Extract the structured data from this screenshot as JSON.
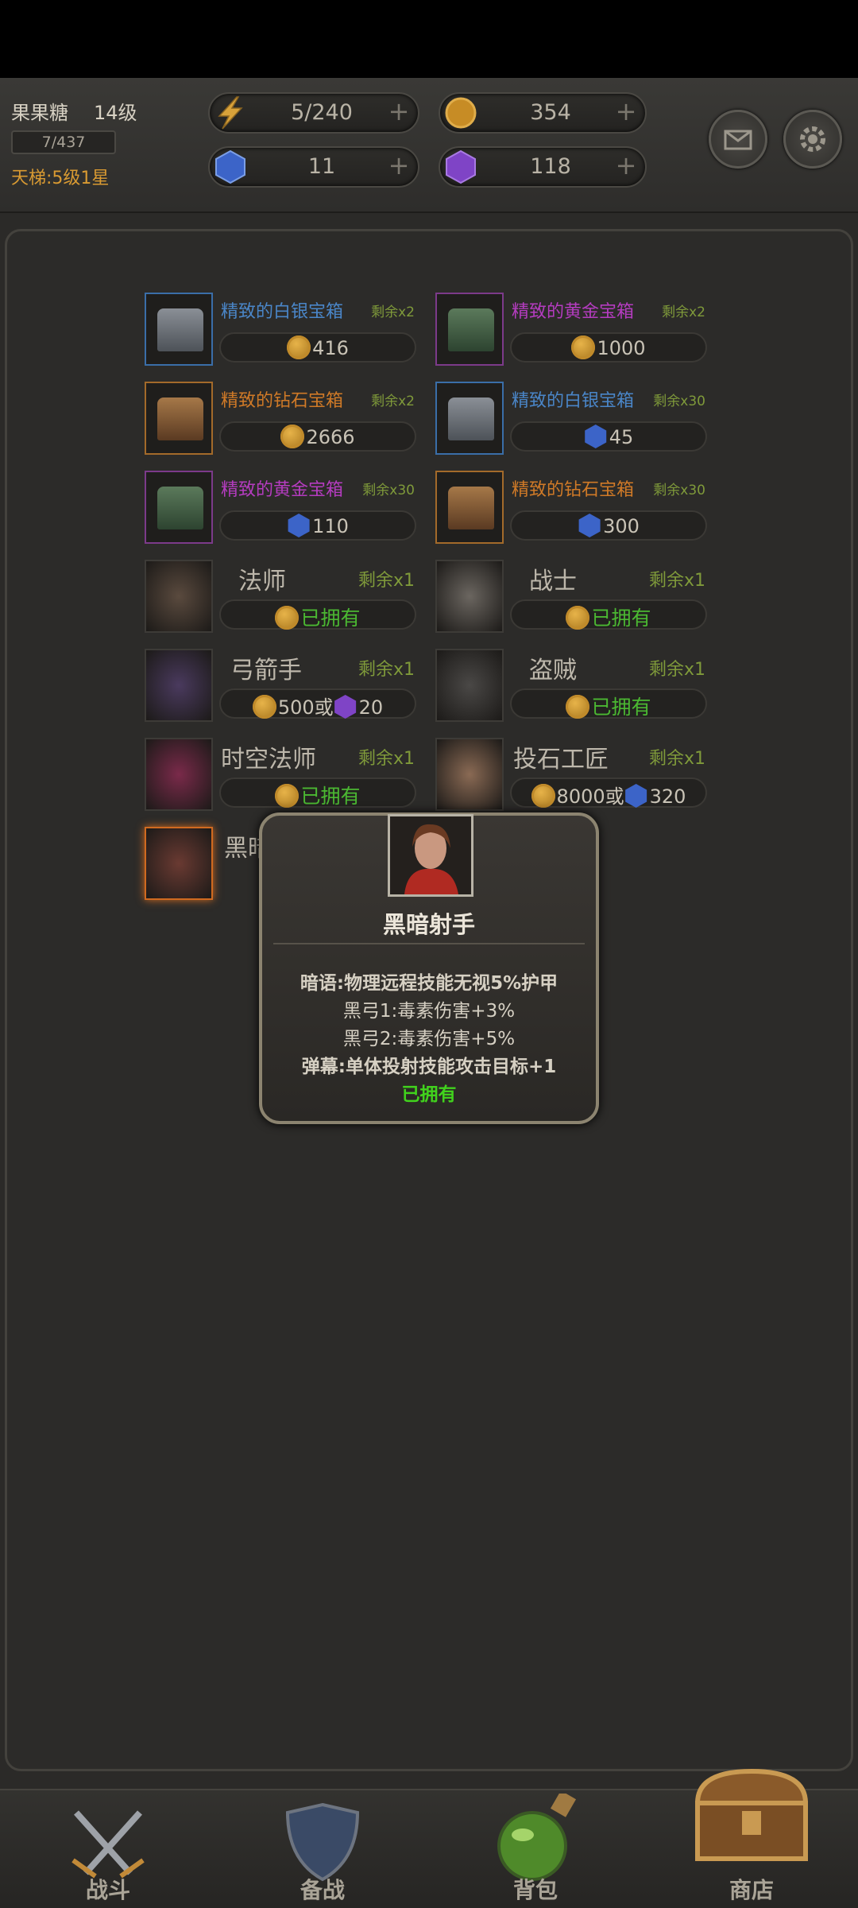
{
  "player": {
    "name": "果果糖",
    "level": "14级",
    "exp": "7/437",
    "ladder": "天梯:5级1星"
  },
  "resources": {
    "energy": "5/240",
    "gold": "354",
    "blue_gem": "11",
    "purple_gem": "118",
    "plus": "+"
  },
  "shop_items": [
    {
      "title": "精致的白银宝箱",
      "remain": "剩余x2",
      "price": "416",
      "currency": "coin",
      "title_color": "#4a86c8"
    },
    {
      "title": "精致的黄金宝箱",
      "remain": "剩余x2",
      "price": "1000",
      "currency": "coin",
      "title_color": "#b53cc0"
    },
    {
      "title": "精致的钻石宝箱",
      "remain": "剩余x2",
      "price": "2666",
      "currency": "coin",
      "title_color": "#d07a27"
    },
    {
      "title": "精致的白银宝箱",
      "remain": "剩余x30",
      "price": "45",
      "currency": "blue_gem",
      "title_color": "#4a86c8"
    },
    {
      "title": "精致的黄金宝箱",
      "remain": "剩余x30",
      "price": "110",
      "currency": "blue_gem",
      "title_color": "#b53cc0"
    },
    {
      "title": "精致的钻石宝箱",
      "remain": "剩余x30",
      "price": "300",
      "currency": "blue_gem",
      "title_color": "#d07a27"
    }
  ],
  "heroes": [
    {
      "name": "法师",
      "remain": "剩余x1",
      "status": "已拥有"
    },
    {
      "name": "战士",
      "remain": "剩余x1",
      "status": "已拥有"
    },
    {
      "name": "弓箭手",
      "remain": "剩余x1",
      "price_coin": "500",
      "or": "或",
      "price_gem": "20"
    },
    {
      "name": "盗贼",
      "remain": "剩余x1",
      "status": "已拥有"
    },
    {
      "name": "时空法师",
      "remain": "剩余x1",
      "status": "已拥有"
    },
    {
      "name": "投石工匠",
      "remain": "剩余x1",
      "price_coin": "8000",
      "or": "或",
      "price_gem": "320"
    },
    {
      "name": "黑暗射手",
      "visible_name": "黑暗"
    }
  ],
  "dialog": {
    "name": "黑暗射手",
    "line1": "暗语:物理远程技能无视5%护甲",
    "line2": "黑弓1:毒素伤害+3%",
    "line3": "黑弓2:毒素伤害+5%",
    "line4": "弹幕:单体投射技能攻击目标+1",
    "status": "已拥有"
  },
  "nav": {
    "battle": "战斗",
    "prepare": "备战",
    "bag": "背包",
    "shop": "商店"
  },
  "colors": {
    "accent_green": "#4bb832",
    "gold": "#d99a32",
    "remain_green": "#7f9a3a"
  }
}
